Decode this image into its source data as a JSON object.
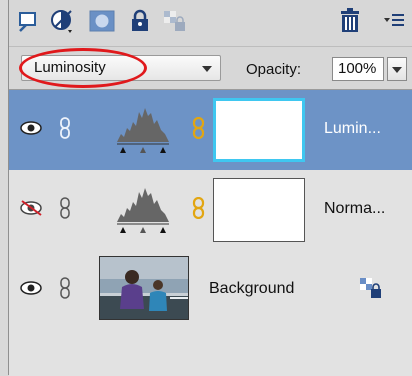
{
  "toolbar": {
    "icons": [
      "new-layer-icon",
      "adjustment-layer-icon",
      "layer-mask-icon",
      "lock-all-icon",
      "lock-transparency-icon",
      "trash-icon",
      "panel-menu-icon"
    ]
  },
  "blend": {
    "mode_value": "Luminosity",
    "opacity_label": "Opacity:",
    "opacity_value": "100%"
  },
  "layers": [
    {
      "name": "Lumin...",
      "selected": true,
      "visible": true,
      "type": "adjustment"
    },
    {
      "name": "Norma...",
      "selected": false,
      "visible": false,
      "type": "adjustment"
    },
    {
      "name": "Background",
      "selected": false,
      "visible": true,
      "type": "image",
      "locked": true
    }
  ],
  "colors": {
    "selection": "#6d93c6",
    "highlight_ring": "#e0191c",
    "mask_border_selected": "#3fc7f0",
    "chain_gold": "#e2a612"
  }
}
